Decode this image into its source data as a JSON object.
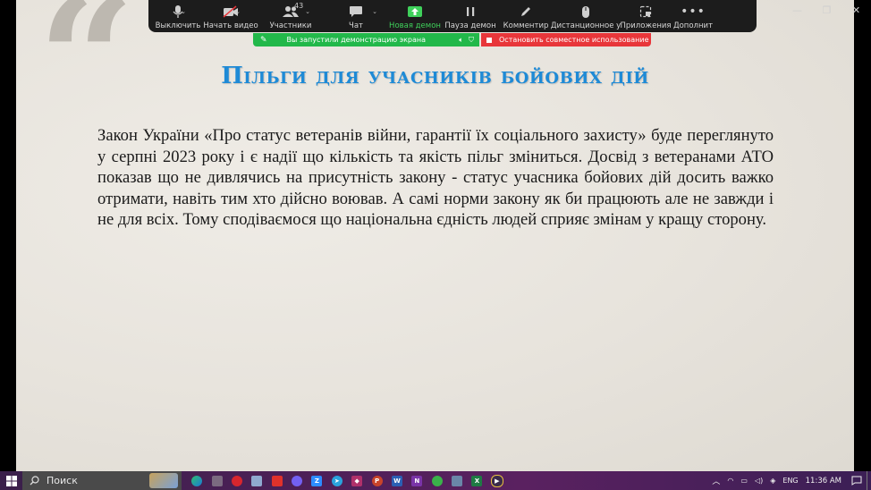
{
  "slide": {
    "title": "Пільги для учасників бойових дій",
    "body": " Закон України «Про статус ветеранів війни, гарантії їх соціального захисту» буде переглянуто у серпні 2023 року і є надії що кількість та якість пільг зміниться. Досвід з ветеранами АТО показав що не дивлячись на присутність закону - статус учасника бойових дій досить важко отримати, навіть тим хто дійсно воював. А самі норми закону як би працюють але не завжди і не для всіх. Тому сподіваємося що національна єдність людей сприяє змінам у кращу сторону."
  },
  "zoom_toolbar": {
    "mute_label": "Выключить",
    "video_label": "Начать видео",
    "participants_label": "Участники",
    "participants_count": "43",
    "chat_label": "Чат",
    "new_share_label": "Новая демон",
    "pause_share_label": "Пауза демон",
    "annotate_label": "Комментир",
    "remote_label": "Дистанционное у",
    "apps_label": "Приложения",
    "more_label": "Дополнит"
  },
  "share_banner": {
    "status_text": "Вы запустили демонстрацию экрана",
    "stop_text": "Остановить совместное использование"
  },
  "taskbar": {
    "search_text": "Поиск",
    "language": "ENG",
    "time": "11:36 AM"
  },
  "colors": {
    "title_blue": "#1e8ad6",
    "share_green": "#22b84a",
    "share_red": "#e8363a",
    "zoom_toolbar_bg": "#1c1c1c"
  }
}
